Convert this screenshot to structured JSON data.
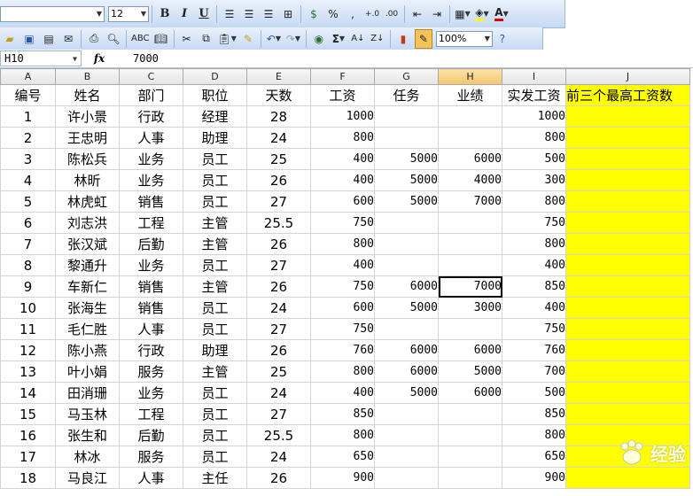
{
  "toolbar": {
    "font_name": "",
    "font_size": "12",
    "bold": "B",
    "italic": "I",
    "underline": "U",
    "percent": "%",
    "comma": ",",
    "sum": "Σ",
    "zoom": "100%",
    "font_color_letter": "A"
  },
  "formula_bar": {
    "cell_ref": "H10",
    "fx": "fx",
    "value": "7000"
  },
  "sheet": {
    "columns": [
      "A",
      "B",
      "C",
      "D",
      "E",
      "F",
      "G",
      "H",
      "I",
      "J"
    ],
    "active_column": "H",
    "headers": [
      "编号",
      "姓名",
      "部门",
      "职位",
      "天数",
      "工资",
      "任务",
      "业绩",
      "实发工资",
      "前三个最高工资数"
    ],
    "rows": [
      [
        "1",
        "许小景",
        "行政",
        "经理",
        "28",
        "1000",
        "",
        "",
        "1000",
        ""
      ],
      [
        "2",
        "王忠明",
        "人事",
        "助理",
        "24",
        "800",
        "",
        "",
        "800",
        ""
      ],
      [
        "3",
        "陈松兵",
        "业务",
        "员工",
        "25",
        "400",
        "5000",
        "6000",
        "500",
        ""
      ],
      [
        "4",
        "林昕",
        "业务",
        "员工",
        "26",
        "400",
        "5000",
        "4000",
        "300",
        ""
      ],
      [
        "5",
        "林虎虹",
        "销售",
        "员工",
        "27",
        "600",
        "5000",
        "7000",
        "800",
        ""
      ],
      [
        "6",
        "刘志洪",
        "工程",
        "主管",
        "25.5",
        "750",
        "",
        "",
        "750",
        ""
      ],
      [
        "7",
        "张汉斌",
        "后勤",
        "主管",
        "26",
        "800",
        "",
        "",
        "800",
        ""
      ],
      [
        "8",
        "黎通升",
        "业务",
        "员工",
        "27",
        "400",
        "",
        "",
        "400",
        ""
      ],
      [
        "9",
        "车新仁",
        "销售",
        "主管",
        "26",
        "750",
        "6000",
        "7000",
        "850",
        ""
      ],
      [
        "10",
        "张海生",
        "销售",
        "员工",
        "24",
        "600",
        "5000",
        "3000",
        "400",
        ""
      ],
      [
        "11",
        "毛仁胜",
        "人事",
        "员工",
        "27",
        "750",
        "",
        "",
        "750",
        ""
      ],
      [
        "12",
        "陈小燕",
        "行政",
        "助理",
        "26",
        "760",
        "6000",
        "6000",
        "760",
        ""
      ],
      [
        "13",
        "叶小娟",
        "服务",
        "主管",
        "25",
        "800",
        "6000",
        "5000",
        "700",
        ""
      ],
      [
        "14",
        "田消珊",
        "业务",
        "员工",
        "24",
        "400",
        "5000",
        "6000",
        "500",
        ""
      ],
      [
        "15",
        "马玉林",
        "工程",
        "员工",
        "27",
        "850",
        "",
        "",
        "850",
        ""
      ],
      [
        "16",
        "张生和",
        "后勤",
        "员工",
        "25.5",
        "800",
        "",
        "",
        "800",
        ""
      ],
      [
        "17",
        "林冰",
        "服务",
        "员工",
        "24",
        "650",
        "",
        "",
        "650",
        ""
      ],
      [
        "18",
        "马良江",
        "人事",
        "主任",
        "26",
        "900",
        "",
        "",
        "900",
        ""
      ]
    ],
    "highlight_color": "#ffff00",
    "selected_cell": "H10"
  },
  "watermark": {
    "text": "经验"
  }
}
